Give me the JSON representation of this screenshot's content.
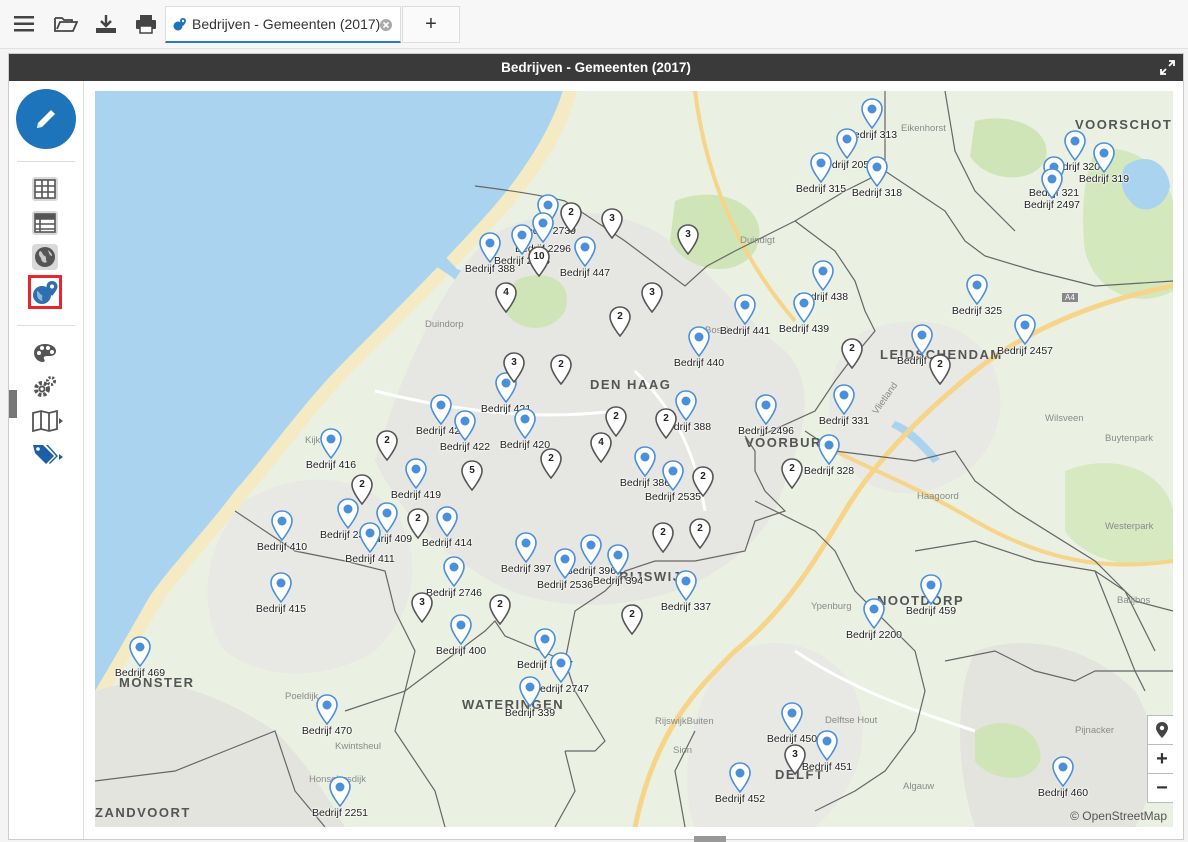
{
  "toolbar": {
    "menu_icon": "hamburger-icon",
    "open_icon": "folder-open-icon",
    "download_icon": "download-icon",
    "print_icon": "printer-icon"
  },
  "tab": {
    "label": "Bedrijven - Gemeenten (2017)",
    "add_label": "+"
  },
  "panel": {
    "title": "Bedrijven - Gemeenten (2017)"
  },
  "sidebar": {
    "items": [
      "edit-icon",
      "table-icon",
      "list-icon",
      "globe-icon",
      "map-pin-globe-icon",
      "palette-icon",
      "gears-icon",
      "map-icon",
      "tags-icon"
    ],
    "highlighted": "map-pin-globe-icon"
  },
  "map": {
    "attribution": "© OpenStreetMap",
    "zoom_in": "+",
    "zoom_out": "−",
    "cities": [
      "DEN HAAG",
      "VOORBURG",
      "LEIDSCHENDAM",
      "RIJSWIJK",
      "NOOTDORP",
      "DELFT",
      "WATERINGEN",
      "MONSTER",
      "VOORSCHOTEN",
      "ZANDVOORT"
    ],
    "places": [
      "Eikenhorst",
      "Duindigt",
      "Duindorp",
      "Kijkduin",
      "Bosch",
      "Vlietland",
      "Wilsveen",
      "Buytenpark",
      "Haagoord",
      "Westerpark",
      "Ypenburg",
      "Balijbos",
      "Poeldijk",
      "Kwintsheul",
      "Delftse Hout",
      "Pijnacker",
      "RijswijkBuiten",
      "Sion",
      "Honselersdijk",
      "Algauw",
      "A4"
    ],
    "markers": [
      {
        "label": "Bedrijf 313"
      },
      {
        "label": "Bedrijf 2054"
      },
      {
        "label": "Bedrijf 315"
      },
      {
        "label": "Bedrijf 318"
      },
      {
        "label": "Bedrijf 320"
      },
      {
        "label": "Bedrijf 321"
      },
      {
        "label": "Bedrijf 319"
      },
      {
        "label": "Bedrijf 2497"
      },
      {
        "label": "Bedrijf 2739"
      },
      {
        "label": "Bedrijf 2296"
      },
      {
        "label": "Bedrijf 2755"
      },
      {
        "label": "Bedrijf 388"
      },
      {
        "label": "Bedrijf 447"
      },
      {
        "label": "Bedrijf 438"
      },
      {
        "label": "Bedrijf 441"
      },
      {
        "label": "Bedrijf 439"
      },
      {
        "label": "Bedrijf 440"
      },
      {
        "label": "Bedrijf 325"
      },
      {
        "label": "Bedrijf 2457"
      },
      {
        "label": "Bedrijf 326"
      },
      {
        "label": "Bedrijf 421"
      },
      {
        "label": "Bedrijf 423"
      },
      {
        "label": "Bedrijf 422"
      },
      {
        "label": "Bedrijf 420"
      },
      {
        "label": "Bedrijf 416"
      },
      {
        "label": "Bedrijf 419"
      },
      {
        "label": "Bedrijf 388"
      },
      {
        "label": "Bedrijf 2496"
      },
      {
        "label": "Bedrijf 331"
      },
      {
        "label": "Bedrijf 328"
      },
      {
        "label": "Bedrijf 386"
      },
      {
        "label": "Bedrijf 2535"
      },
      {
        "label": "Bedrijf 410"
      },
      {
        "label": "Bedrijf 2381"
      },
      {
        "label": "Bedrijf 409"
      },
      {
        "label": "Bedrijf 411"
      },
      {
        "label": "Bedrijf 414"
      },
      {
        "label": "Bedrijf 397"
      },
      {
        "label": "Bedrijf 396"
      },
      {
        "label": "Bedrijf 394"
      },
      {
        "label": "Bedrijf 2536"
      },
      {
        "label": "Bedrijf 2746"
      },
      {
        "label": "Bedrijf 415"
      },
      {
        "label": "Bedrijf 337"
      },
      {
        "label": "Bedrijf 400"
      },
      {
        "label": "Bedrijf 2697"
      },
      {
        "label": "Bedrijf 2747"
      },
      {
        "label": "Bedrijf 339"
      },
      {
        "label": "Bedrijf 469"
      },
      {
        "label": "Bedrijf 470"
      },
      {
        "label": "Bedrijf 2251"
      },
      {
        "label": "Bedrijf 2200"
      },
      {
        "label": "Bedrijf 459"
      },
      {
        "label": "Bedrijf 450"
      },
      {
        "label": "Bedrijf 451"
      },
      {
        "label": "Bedrijf 452"
      },
      {
        "label": "Bedrijf 460"
      }
    ],
    "clusters": [
      "2",
      "3",
      "3",
      "4",
      "3",
      "2",
      "2",
      "3",
      "2",
      "2",
      "2",
      "2",
      "2",
      "5",
      "2",
      "4",
      "2",
      "2",
      "2",
      "2",
      "2",
      "2",
      "2",
      "3",
      "2",
      "3",
      "10"
    ]
  },
  "colors": {
    "accent": "#1d74bb",
    "marker": "#4a8fd9",
    "highlight": "#e8262e",
    "titlebar": "#3a3a3a",
    "water": "#aad3f0"
  }
}
